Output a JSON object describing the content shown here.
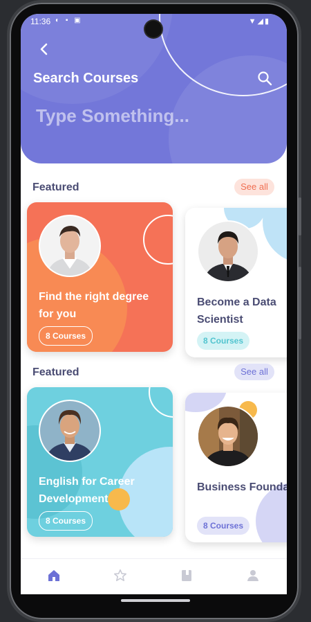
{
  "status_bar": {
    "time": "11:36"
  },
  "header": {
    "title": "Search Courses",
    "search_placeholder": "Type Something..."
  },
  "sections": [
    {
      "title": "Featured",
      "see_all": "See all",
      "cards": [
        {
          "title": "Find the right degree for you",
          "count": "8 Courses"
        },
        {
          "title": "Become a Data Scientist",
          "count": "8 Courses"
        }
      ]
    },
    {
      "title": "Featured",
      "see_all": "See all",
      "cards": [
        {
          "title": "English for Career Development",
          "count": "8 Courses"
        },
        {
          "title": "Business Foundation",
          "count": "8 Courses"
        }
      ]
    }
  ],
  "bottom_nav": {
    "items": [
      {
        "icon": "home-icon",
        "active": true
      },
      {
        "icon": "star-icon",
        "active": false
      },
      {
        "icon": "book-icon",
        "active": false
      },
      {
        "icon": "user-icon",
        "active": false
      }
    ]
  },
  "colors": {
    "header": "#7377d9",
    "orange_card": "#f57257",
    "teal_card": "#6ed0df",
    "accent": "#6d71d6"
  }
}
